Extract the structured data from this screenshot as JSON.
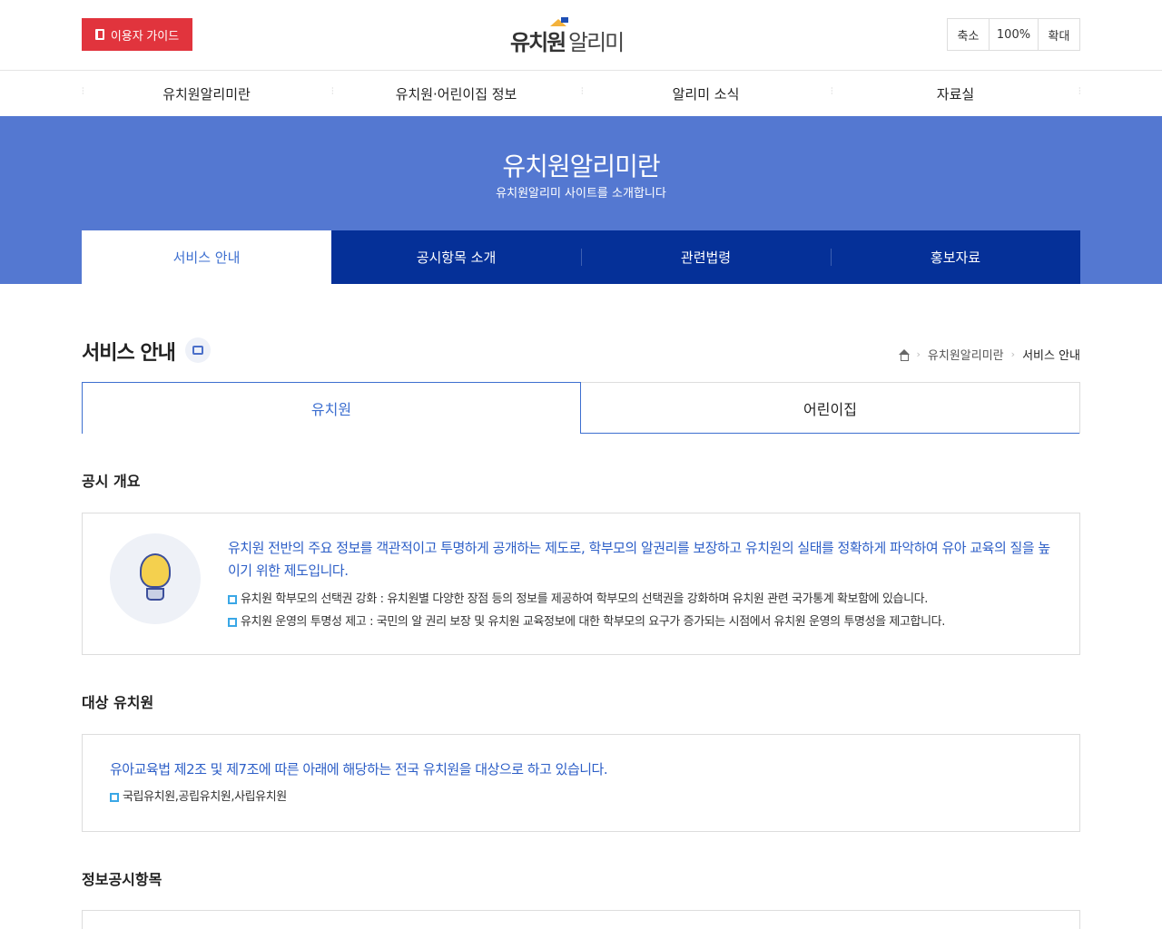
{
  "header": {
    "guide_label": "이용자 가이드",
    "logo_bold": "유치원",
    "logo_light": "알리미",
    "zoom": {
      "out": "축소",
      "level": "100%",
      "in": "확대"
    }
  },
  "gnb": [
    "유치원알리미란",
    "유치원·어린이집 정보",
    "알리미 소식",
    "자료실"
  ],
  "banner": {
    "title": "유치원알리미란",
    "subtitle": "유치원알리미 사이트를 소개합니다",
    "tabs": [
      "서비스 안내",
      "공시항목 소개",
      "관련법령",
      "홍보자료"
    ]
  },
  "page": {
    "title": "서비스 안내",
    "breadcrumb": [
      "유치원알리미란",
      "서비스 안내"
    ]
  },
  "kind_tabs": [
    "유치원",
    "어린이집"
  ],
  "sections": {
    "overview": {
      "heading": "공시 개요",
      "lead": "유치원 전반의 주요 정보를 객관적이고 투명하게 공개하는 제도로, 학부모의 알권리를 보장하고 유치원의 실태를 정확하게 파악하여 유아 교육의 질을 높이기 위한 제도입니다.",
      "items": [
        "유치원 학부모의 선택권 강화 : 유치원별 다양한 장점 등의 정보를 제공하여 학부모의 선택권을 강화하며 유치원 관련 국가통계 확보함에 있습니다.",
        "유치원 운영의 투명성 제고 : 국민의 알 권리 보장 및 유치원 교육정보에 대한 학부모의 요구가 증가되는 시점에서 유치원 운영의 투명성을 제고합니다."
      ]
    },
    "target": {
      "heading": "대상 유치원",
      "lead": "유아교육법 제2조 및 제7조에 따른 아래에 해당하는 전국 유치원을 대상으로 하고 있습니다.",
      "items": [
        "국립유치원,공립유치원,사립유치원"
      ]
    },
    "items_heading": "정보공시항목"
  }
}
